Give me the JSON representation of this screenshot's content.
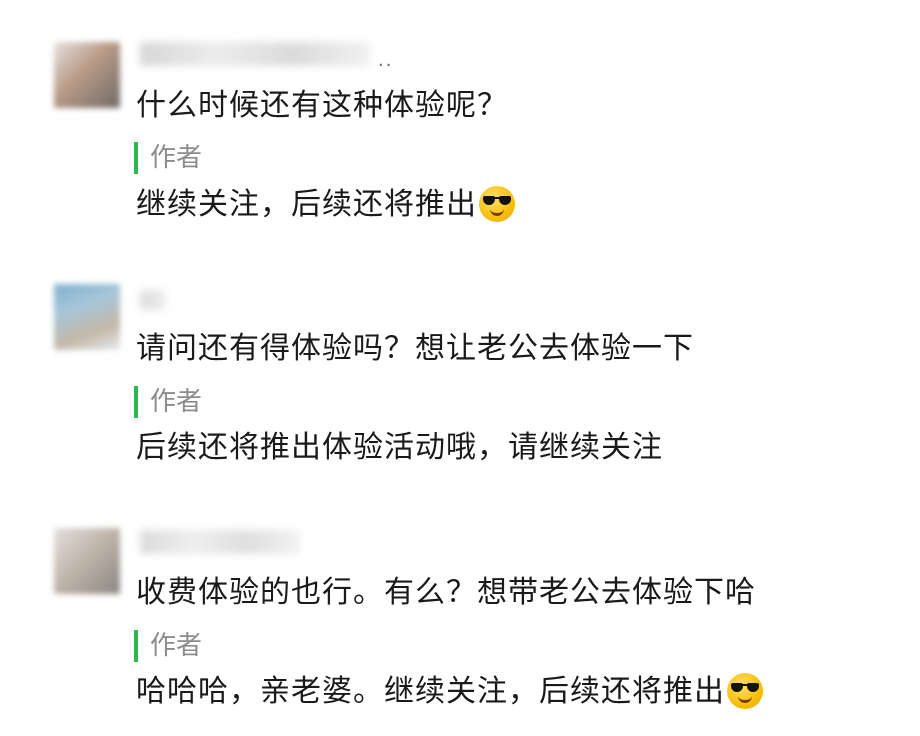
{
  "comments": [
    {
      "nickname_suffix": "..",
      "text": "什么时候还有这种体验呢？",
      "reply": {
        "label": "作者",
        "text": "继续关注，后续还将推出",
        "emoji": "cool-sunglasses-emoji"
      },
      "avatar_colors": [
        "#6f6a66",
        "#b79a86",
        "#e7e2de"
      ]
    },
    {
      "nickname_suffix": "",
      "text": "请问还有得体验吗？想让老公去体验一下",
      "reply": {
        "label": "作者",
        "text": "后续还将推出体验活动哦，请继续关注",
        "emoji": ""
      },
      "avatar_colors": [
        "#7fb1cf",
        "#c4b7a8",
        "#e5ebef"
      ]
    },
    {
      "nickname_suffix": "",
      "text": "收费体验的也行。有么？想带老公去体验下哈",
      "reply": {
        "label": "作者",
        "text": "哈哈哈，亲老婆。继续关注，后续还将推出",
        "emoji": "cool-sunglasses-emoji"
      },
      "avatar_colors": [
        "#8a8580",
        "#bdb2a8",
        "#e4e0dc"
      ]
    }
  ],
  "colors": {
    "reply_bar": "#2db84d",
    "reply_label": "#8c8c8c",
    "text": "#1a1a1a"
  }
}
